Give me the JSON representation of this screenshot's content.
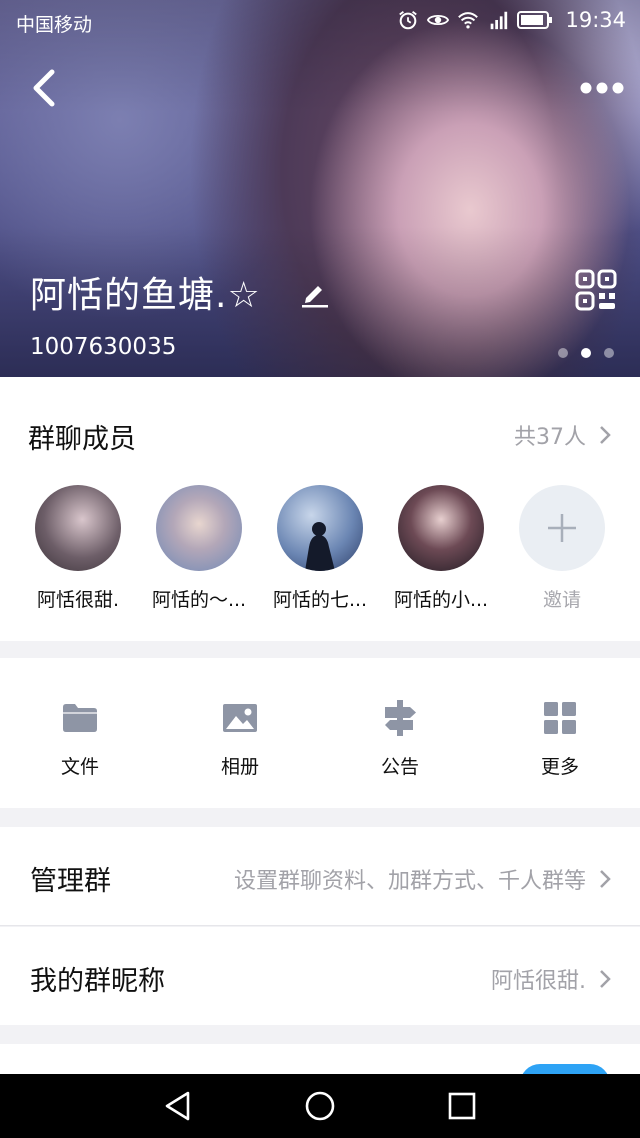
{
  "status_bar": {
    "carrier": "中国移动",
    "time": "19:34"
  },
  "header": {
    "group_name": "阿恬的鱼塘.☆",
    "group_id": "1007630035",
    "page_dots": 3,
    "active_dot": 2
  },
  "members": {
    "title": "群聊成员",
    "count_label": "共37人",
    "list": [
      {
        "name": "阿恬很甜."
      },
      {
        "name": "阿恬的～..."
      },
      {
        "name": "阿恬的七..."
      },
      {
        "name": "阿恬的小..."
      }
    ],
    "invite_label": "邀请"
  },
  "tools": [
    {
      "label": "文件",
      "icon": "folder-icon"
    },
    {
      "label": "相册",
      "icon": "photo-icon"
    },
    {
      "label": "公告",
      "icon": "signpost-icon"
    },
    {
      "label": "更多",
      "icon": "grid-icon"
    }
  ],
  "settings": {
    "manage": {
      "label": "管理群",
      "value": "设置群聊资料、加群方式、千人群等"
    },
    "nickname": {
      "label": "我的群昵称",
      "value": "阿恬很甜."
    }
  },
  "colors": {
    "accent": "#2ea3f5",
    "icon_gray": "#8e95a5",
    "hint_gray": "#a2a2a8"
  }
}
